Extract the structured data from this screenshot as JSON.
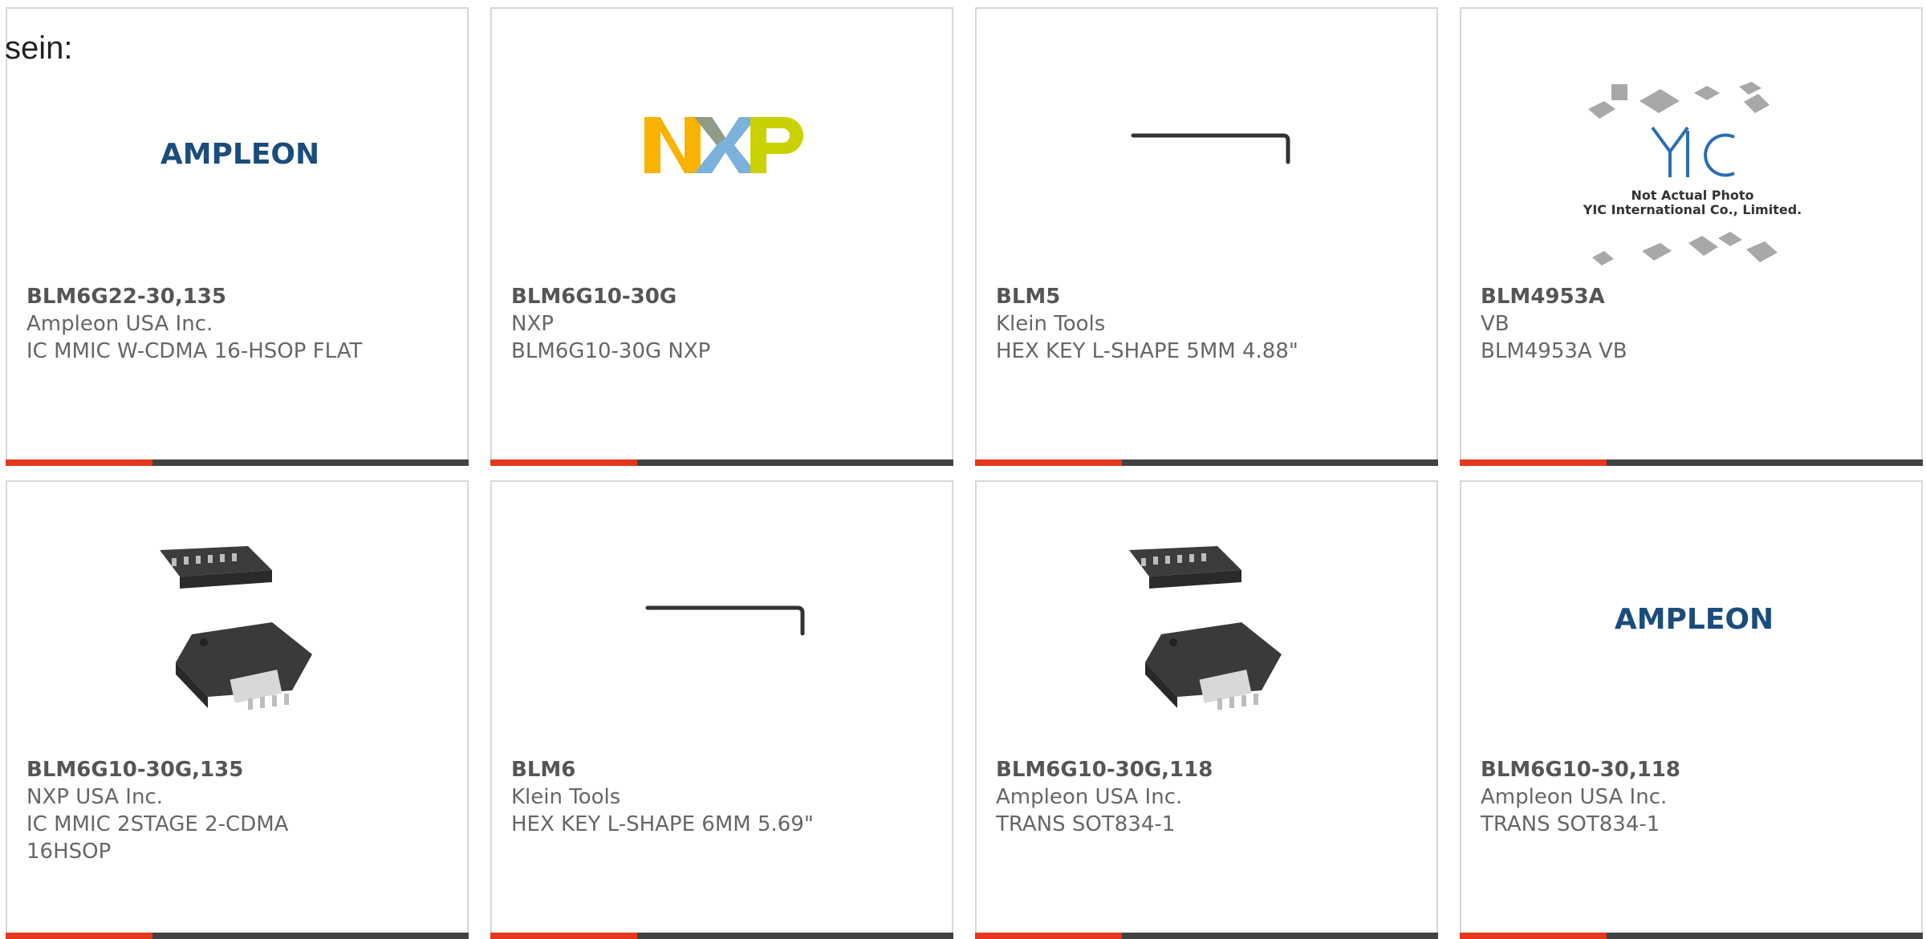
{
  "heading": "sein:",
  "cards": [
    {
      "part": "BLM6G22-30,135",
      "manufacturer": "Ampleon USA Inc.",
      "description": "IC MMIC W-CDMA 16-HSOP FLAT",
      "image": "ampleon-logo",
      "logo_text": "AMPLEON"
    },
    {
      "part": "BLM6G10-30G",
      "manufacturer": "NXP",
      "description": "BLM6G10-30G NXP",
      "image": "nxp-logo"
    },
    {
      "part": "BLM5",
      "manufacturer": "Klein Tools",
      "description": "HEX KEY L-SHAPE 5MM 4.88\"",
      "image": "hex-key-icon"
    },
    {
      "part": "BLM4953A",
      "manufacturer": "VB",
      "description": "BLM4953A VB",
      "image": "not-actual-photo",
      "photo_note_1": "Not Actual Photo",
      "photo_note_2": "YIC International Co., Limited."
    },
    {
      "part": "BLM6G10-30G,135",
      "manufacturer": "NXP USA Inc.",
      "description": "IC MMIC 2STAGE 2-CDMA",
      "description2": "16HSOP",
      "image": "hsop-package"
    },
    {
      "part": "BLM6",
      "manufacturer": "Klein Tools",
      "description": "HEX KEY L-SHAPE 6MM 5.69\"",
      "image": "hex-key-icon"
    },
    {
      "part": "BLM6G10-30G,118",
      "manufacturer": "Ampleon USA Inc.",
      "description": "TRANS SOT834-1",
      "image": "hsop-package"
    },
    {
      "part": "BLM6G10-30,118",
      "manufacturer": "Ampleon USA Inc.",
      "description": "TRANS SOT834-1",
      "image": "ampleon-logo",
      "logo_text": "AMPLEON"
    }
  ],
  "colors": {
    "accent": "#e5371c",
    "bar": "#424242",
    "border": "#d8d8d8"
  }
}
